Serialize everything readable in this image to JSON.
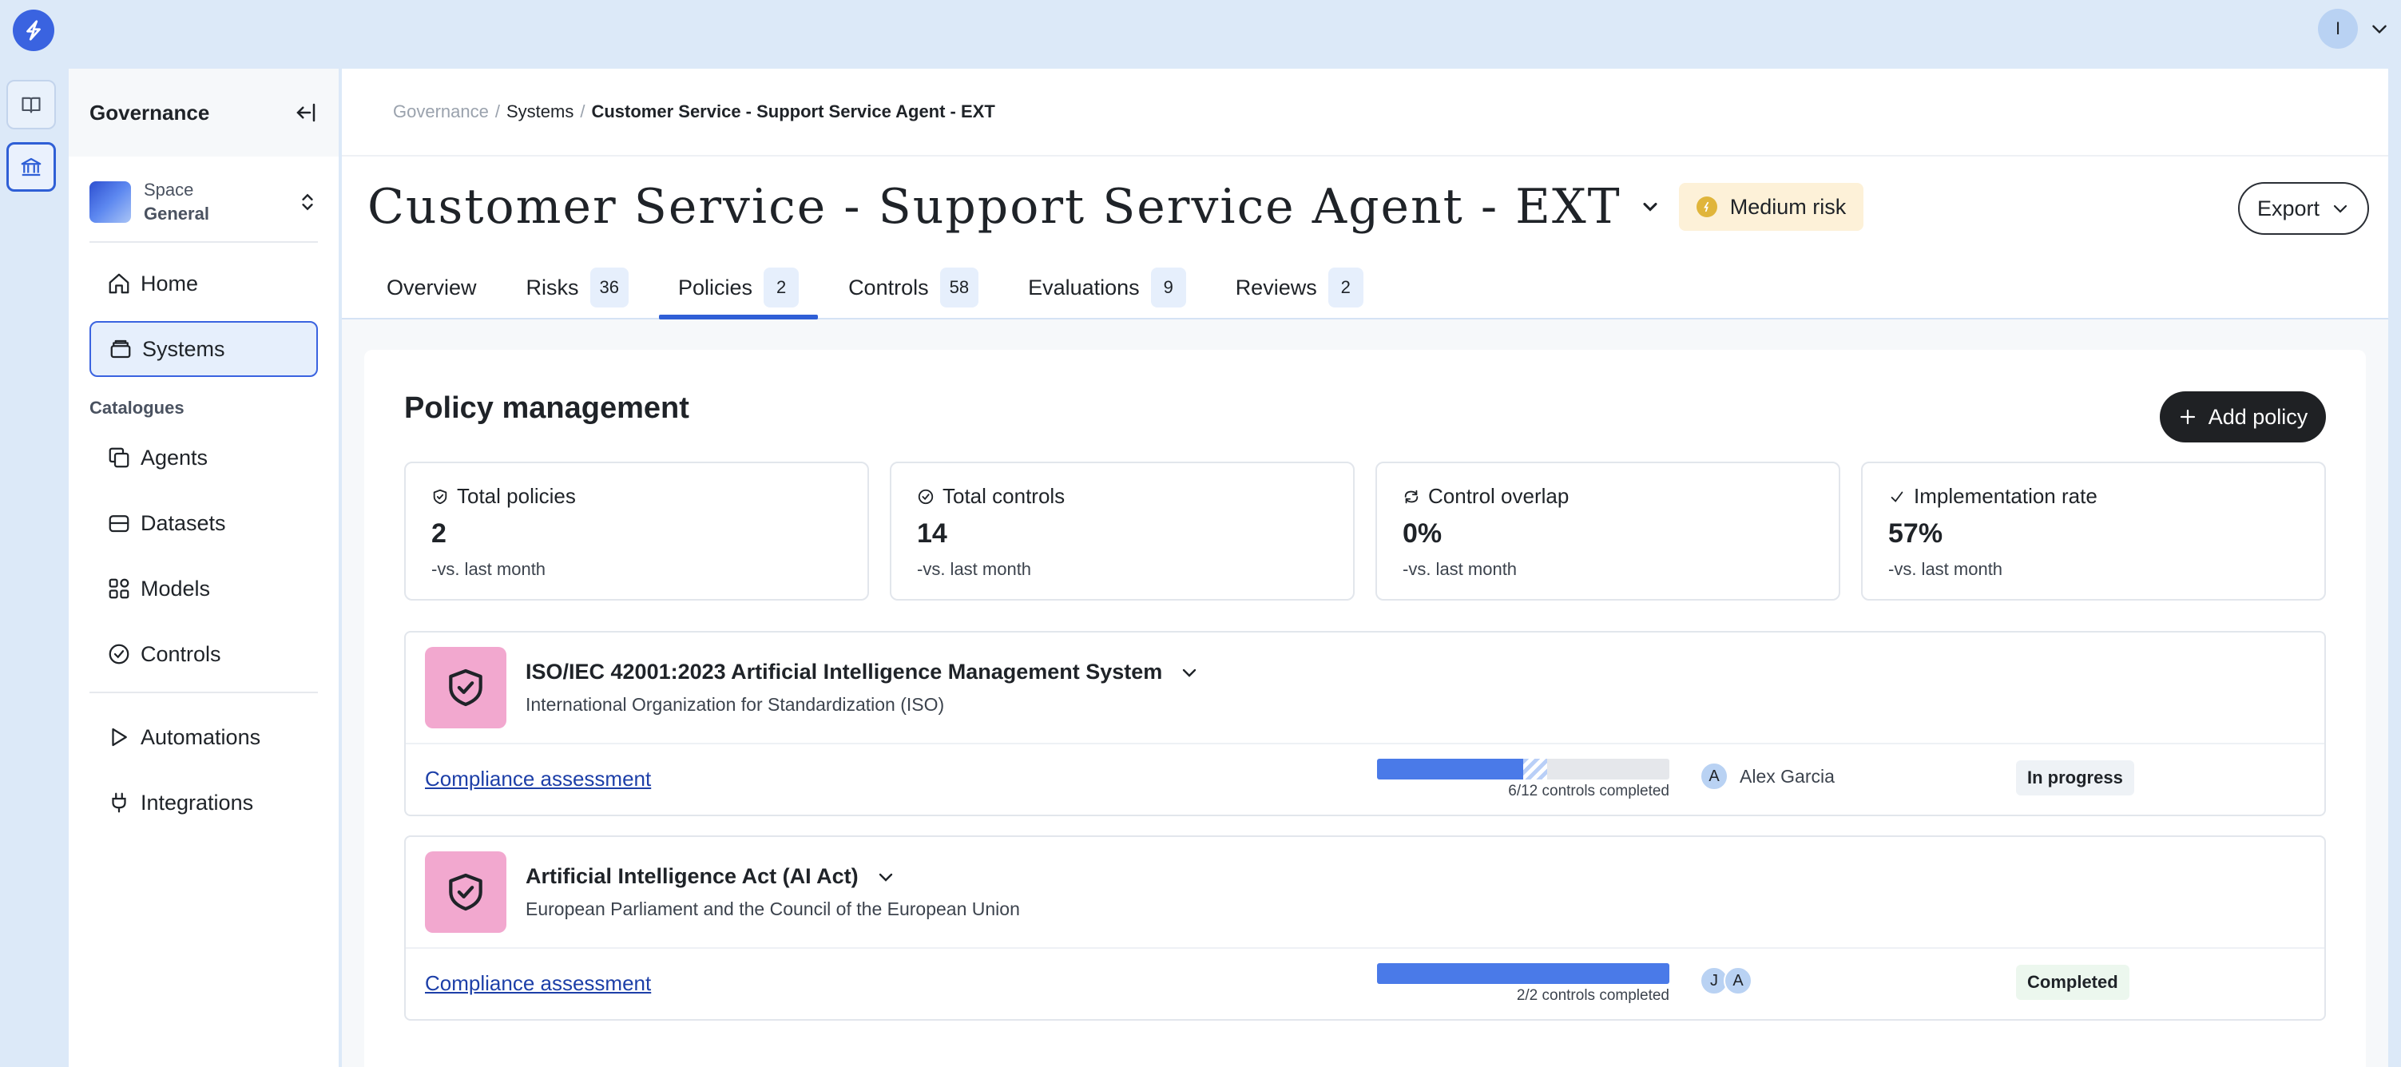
{
  "app": {
    "logo_icon": "bolt-icon"
  },
  "user": {
    "avatar_initial": "I"
  },
  "rail": {
    "items": [
      {
        "icon": "book-open-icon"
      },
      {
        "icon": "bank-icon"
      }
    ]
  },
  "sidebar": {
    "title": "Governance",
    "space": {
      "label": "Space",
      "name": "General"
    },
    "items": [
      {
        "label": "Home",
        "icon": "home-icon"
      },
      {
        "label": "Systems",
        "icon": "stack-icon"
      }
    ],
    "catalogues_heading": "Catalogues",
    "catalogue_items": [
      {
        "label": "Agents",
        "icon": "copy-icon"
      },
      {
        "label": "Datasets",
        "icon": "database-icon"
      },
      {
        "label": "Models",
        "icon": "grid-plus-icon"
      },
      {
        "label": "Controls",
        "icon": "check-circle-icon"
      }
    ],
    "other_items": [
      {
        "label": "Automations",
        "icon": "play-icon"
      },
      {
        "label": "Integrations",
        "icon": "plug-icon"
      }
    ]
  },
  "breadcrumb": {
    "root": "Governance",
    "mid": "Systems",
    "current": "Customer Service - Support Service Agent - EXT",
    "sep": "/"
  },
  "header": {
    "title": "Customer Service - Support Service Agent - EXT",
    "risk": "Medium risk",
    "export_label": "Export"
  },
  "tabs": [
    {
      "label": "Overview",
      "count": null
    },
    {
      "label": "Risks",
      "count": "36"
    },
    {
      "label": "Policies",
      "count": "2"
    },
    {
      "label": "Controls",
      "count": "58"
    },
    {
      "label": "Evaluations",
      "count": "9"
    },
    {
      "label": "Reviews",
      "count": "2"
    }
  ],
  "policy_mgmt": {
    "title": "Policy management",
    "add_label": "Add policy",
    "stats": [
      {
        "label": "Total policies",
        "value": "2",
        "delta": "-",
        "sub": "vs. last month",
        "icon": "shield-check-icon"
      },
      {
        "label": "Total controls",
        "value": "14",
        "delta": "-",
        "sub": "vs. last month",
        "icon": "check-circle-icon"
      },
      {
        "label": "Control overlap",
        "value": "0%",
        "delta": "-",
        "sub": "vs. last month",
        "icon": "refresh-icon"
      },
      {
        "label": "Implementation rate",
        "value": "57%",
        "delta": "-",
        "sub": "vs. last month",
        "icon": "check-icon"
      }
    ],
    "policies": [
      {
        "name": "ISO/IEC 42001:2023 Artificial Intelligence Management System",
        "org": "International Organization for Standardization (ISO)",
        "assessment": "Compliance assessment",
        "progress": 0.5,
        "progress_text": "6/12 controls completed",
        "assignees": [
          "A"
        ],
        "assignee_name": "Alex Garcia",
        "status": "In progress"
      },
      {
        "name": "Artificial Intelligence Act (AI Act)",
        "org": "European Parliament and the Council of the European Union",
        "assessment": "Compliance assessment",
        "progress": 1.0,
        "progress_text": "2/2 controls completed",
        "assignees": [
          "J",
          "A"
        ],
        "assignee_name": "",
        "status": "Completed"
      }
    ]
  },
  "colors": {
    "accent": "#2f5fd6",
    "policy_icon_bg": "#f2a8cf",
    "risk_bg": "#fdf1d8",
    "progress": "#4a7ae8"
  }
}
